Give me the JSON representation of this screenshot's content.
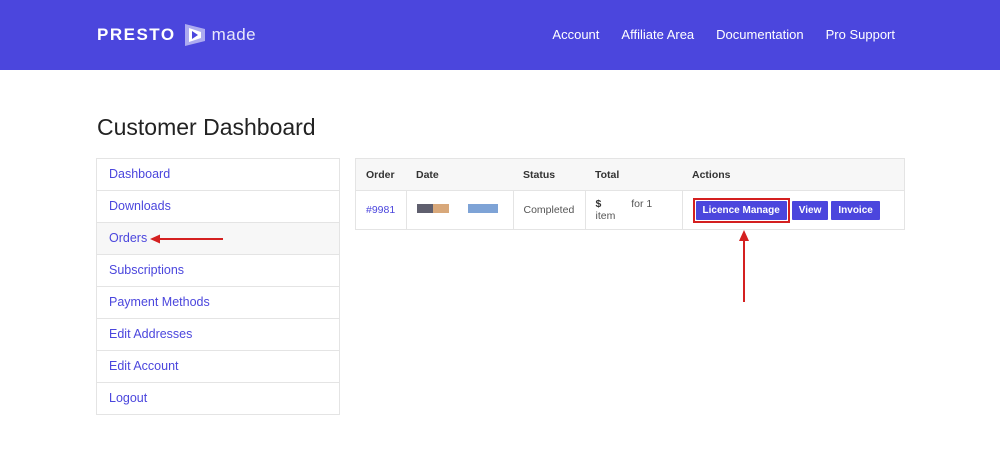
{
  "header": {
    "logo_part1": "PRESTO",
    "logo_part2": "made",
    "nav": [
      "Account",
      "Affiliate Area",
      "Documentation",
      "Pro Support"
    ]
  },
  "page_title": "Customer Dashboard",
  "sidebar": {
    "items": [
      {
        "label": "Dashboard"
      },
      {
        "label": "Downloads"
      },
      {
        "label": "Orders",
        "active": true
      },
      {
        "label": "Subscriptions"
      },
      {
        "label": "Payment Methods"
      },
      {
        "label": "Edit Addresses"
      },
      {
        "label": "Edit Account"
      },
      {
        "label": "Logout"
      }
    ]
  },
  "orders": {
    "columns": [
      "Order",
      "Date",
      "Status",
      "Total",
      "Actions"
    ],
    "rows": [
      {
        "order": "#9981",
        "status": "Completed",
        "total_symbol": "$",
        "total_items": "for 1 item",
        "actions": [
          "Licence Manage",
          "View",
          "Invoice"
        ]
      }
    ]
  },
  "colors": {
    "brand": "#4b46dd",
    "annotation": "#d42020"
  }
}
